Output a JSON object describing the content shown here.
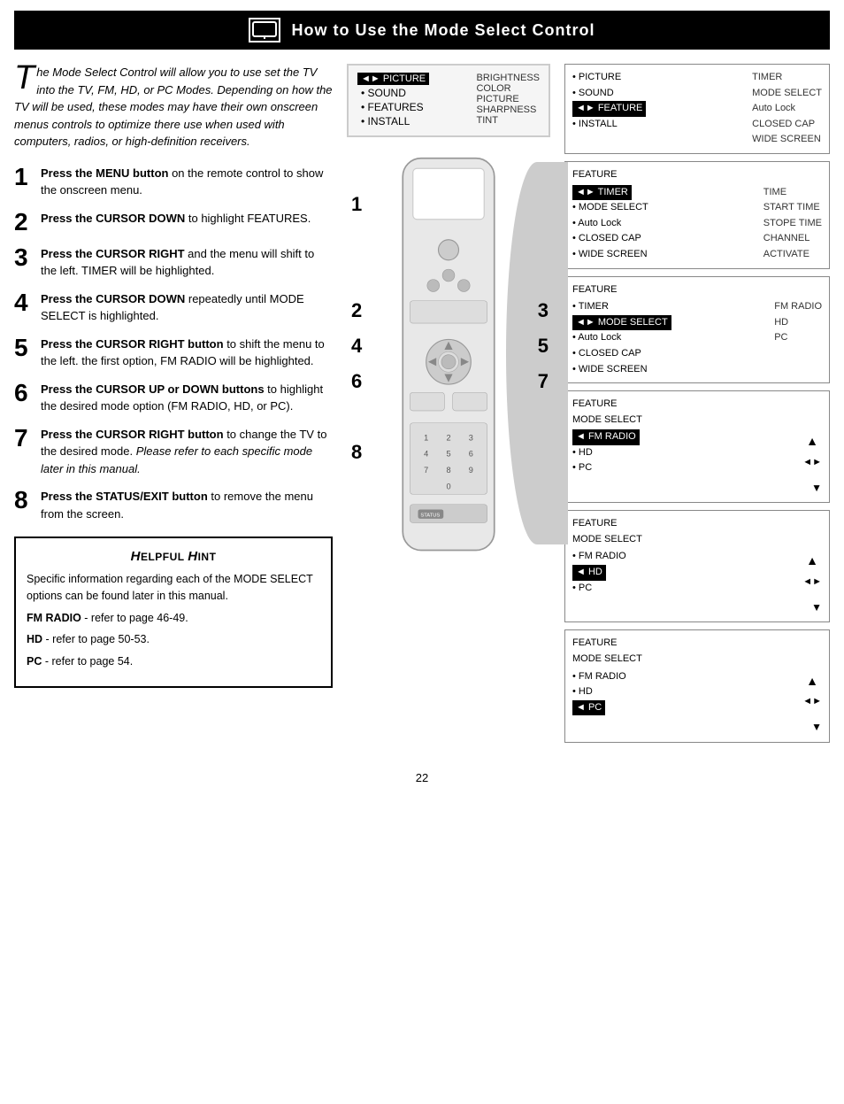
{
  "header": {
    "title": "How to Use the Mode Select Control",
    "icon_label": "TV icon"
  },
  "intro": {
    "drop_cap": "T",
    "text": "he Mode Select Control will allow you to use set the TV into the TV, FM, HD, or PC Modes. Depending on how the TV will be used, these modes may have their own onscreen menus controls to optimize there use when used with computers, radios, or high-definition receivers."
  },
  "steps": [
    {
      "number": "1",
      "bold": "Press the MENU button",
      "rest": " on the remote control to show the onscreen menu."
    },
    {
      "number": "2",
      "bold": "Press the CURSOR DOWN",
      "rest": " to highlight FEATURES."
    },
    {
      "number": "3",
      "bold": "Press the CURSOR RIGHT",
      "rest": " and the menu will shift to the left. TIMER will be highlighted."
    },
    {
      "number": "4",
      "bold": "Press the CURSOR DOWN",
      "rest": " repeatedly until MODE SELECT is highlighted."
    },
    {
      "number": "5",
      "bold": "Press the CURSOR RIGHT button",
      "rest": " to shift the menu to the left. the first option, FM RADIO will be highlighted."
    },
    {
      "number": "6",
      "bold": "Press the CURSOR UP or DOWN buttons",
      "rest": " to highlight the desired mode option (FM RADIO, HD, or PC)."
    },
    {
      "number": "7",
      "bold": "Press the CURSOR RIGHT button",
      "rest": " to change the TV to the desired mode. ",
      "italic": "Please refer to each specific mode later in this manual."
    },
    {
      "number": "8",
      "bold": "Press the STATUS/EXIT button",
      "rest": " to remove the menu from the screen."
    }
  ],
  "hint": {
    "title": "Helpful Hint",
    "body": "Specific information regarding each of the MODE SELECT options can be found later in this manual.",
    "items": [
      {
        "label": "FM RADIO",
        "text": "- refer to page 46-49."
      },
      {
        "label": "HD",
        "text": "- refer to page 50-53."
      },
      {
        "label": "PC",
        "text": "- refer to page 54."
      }
    ]
  },
  "screen1": {
    "highlight": "◄► PICTURE",
    "items": [
      "• SOUND",
      "• FEATURES",
      "• INSTALL"
    ],
    "right_items": [
      "BRIGHTNESS",
      "COLOR",
      "PICTURE",
      "SHARPNESS",
      "TINT"
    ]
  },
  "screen2": {
    "items": [
      "• PICTURE",
      "• SOUND",
      "◄► FEATURE",
      "• INSTALL"
    ],
    "right_items": [
      "TIMER",
      "MODE SELECT",
      "Auto Lock",
      "CLOSED CAP",
      "WIDE SCREEN"
    ]
  },
  "screen3": {
    "title": "FEATURE",
    "highlight": "◄► TIMER",
    "items": [
      "• MODE SELECT",
      "• Auto Lock",
      "• CLOSED CAP",
      "• WIDE SCREEN"
    ],
    "right_items": [
      "TIME",
      "START TIME",
      "STOPE TIME",
      "CHANNEL",
      "ACTIVATE"
    ]
  },
  "screen4": {
    "title": "FEATURE",
    "items": [
      "• TIMER",
      "◄► MODE SELECT",
      "• Auto Lock",
      "• CLOSED CAP",
      "• WIDE SCREEN"
    ],
    "right_items": [
      "FM RADIO",
      "HD",
      "PC"
    ]
  },
  "screen5": {
    "title": "FEATURE MODE SELECT",
    "highlight": "◄ FM RADIO",
    "items": [
      "• HD",
      "• PC"
    ],
    "arrow": "◄►"
  },
  "screen6": {
    "title": "FEATURE MODE SELECT",
    "highlight": "◄ HD",
    "items": [
      "• FM RADIO",
      "• PC"
    ],
    "arrow": "◄►"
  },
  "screen7": {
    "title": "FEATURE MODE SELECT",
    "highlight": "◄ PC",
    "items": [
      "• FM RADIO",
      "• HD"
    ],
    "arrow": "◄►"
  },
  "page_number": "22"
}
